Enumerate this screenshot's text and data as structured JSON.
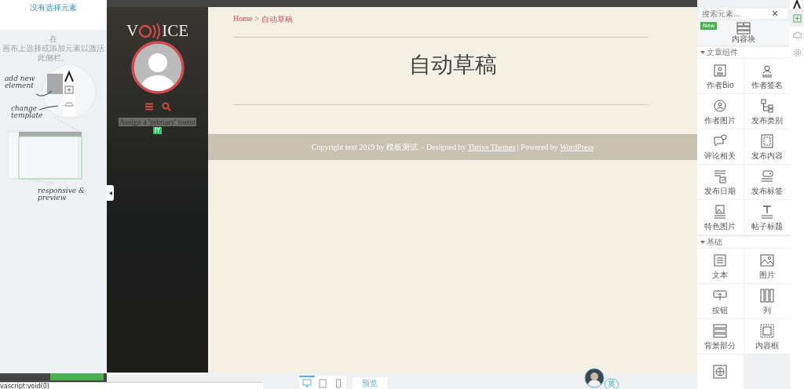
{
  "left_panel": {
    "title": "没有选择元素",
    "hint_line_1": "在",
    "hint_line_2": "画布上选择或添加元素以激活此侧栏。",
    "tutorial": {
      "add_label": "add new element",
      "template_label": "change template",
      "preview_label": "responsive & preview"
    }
  },
  "theme_sidebar": {
    "logo_left": "V",
    "logo_right": "ICE",
    "menu_notice": "Assign a 'primary' menu",
    "notice_badge": "IY"
  },
  "content": {
    "breadcrumb": {
      "home": "Home",
      "separator": ">",
      "current": "自动草稿"
    },
    "title": "自动草稿",
    "footer": [
      {
        "kind": "text",
        "text": "Copyright text 2019 by 模板测试.  - Designed by "
      },
      {
        "kind": "link",
        "text": "Thrive Themes"
      },
      {
        "kind": "text",
        "text": " | Powered by "
      },
      {
        "kind": "link",
        "text": "WordPress"
      }
    ]
  },
  "bottom_toolbar": {
    "devices": [
      {
        "selected": true
      },
      {
        "selected": false
      },
      {
        "selected": false
      }
    ],
    "preview": "预览",
    "avatar_badge": "英"
  },
  "right_panel": {
    "search": {
      "placeholder": "搜索元素..."
    },
    "featured": {
      "badge": "New",
      "label": "内容块"
    },
    "sections": [
      {
        "title": "文章组件",
        "expanded": true,
        "items": [
          {
            "label": "作者Bio"
          },
          {
            "label": "作者签名"
          },
          {
            "label": "作者图片"
          },
          {
            "label": "发布类别"
          },
          {
            "label": "评论相关"
          },
          {
            "label": "发布内容"
          },
          {
            "label": "发布日期"
          },
          {
            "label": "发布标签"
          },
          {
            "label": "特色图片"
          },
          {
            "label": "帖子标题"
          }
        ]
      },
      {
        "title": "基础",
        "expanded": true,
        "more_below": true,
        "items": [
          {
            "label": "文本"
          },
          {
            "label": "图片"
          },
          {
            "label": "按钮"
          },
          {
            "label": "列"
          },
          {
            "label": "背景部分"
          },
          {
            "label": "内容框"
          }
        ]
      }
    ]
  },
  "side_tools": [
    {
      "selected": true
    },
    {
      "selected": false
    },
    {
      "selected": false
    }
  ],
  "status_bar": "vascript:void(0)"
}
